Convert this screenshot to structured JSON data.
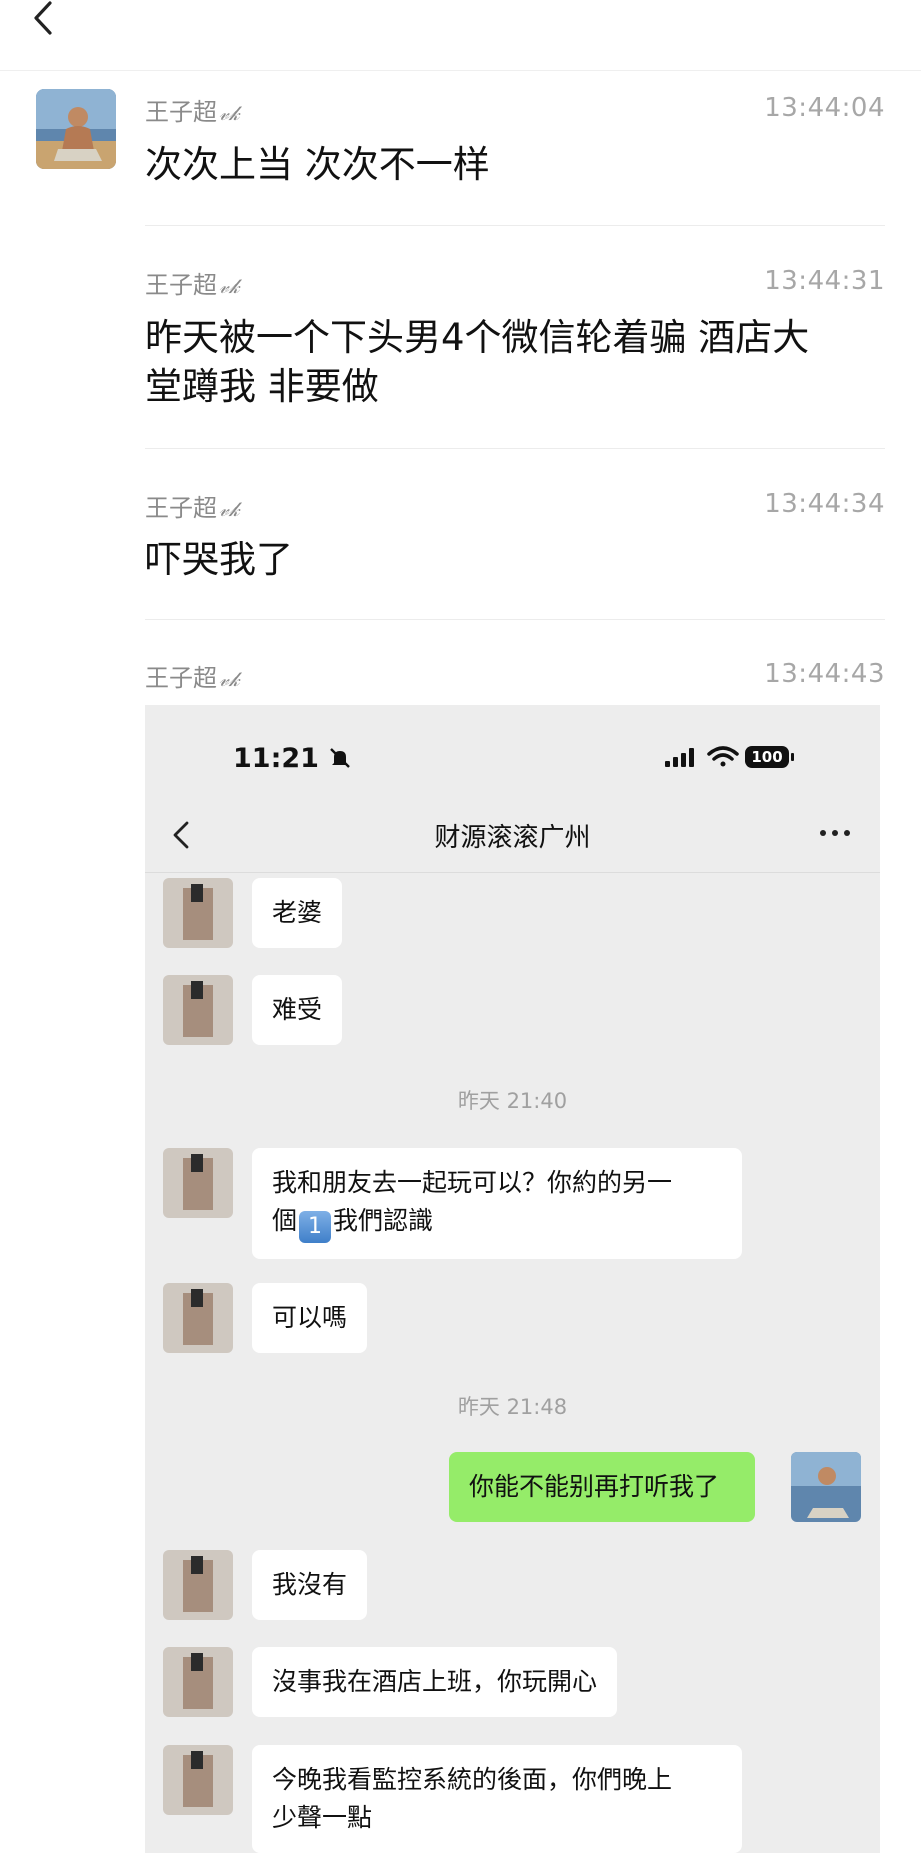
{
  "thread": {
    "messages": [
      {
        "sender": "王子超",
        "verified_mark": "𝓋𝓀",
        "time": "13:44:04",
        "text": "次次上当 次次不一样"
      },
      {
        "sender": "王子超",
        "verified_mark": "𝓋𝓀",
        "time": "13:44:31",
        "text_line1": "昨天被一个下头男4个微信轮着骗 酒店大",
        "text_line2": "堂蹲我 非要做"
      },
      {
        "sender": "王子超",
        "verified_mark": "𝓋𝓀",
        "time": "13:44:34",
        "text": "吓哭我了"
      },
      {
        "sender": "王子超",
        "verified_mark": "𝓋𝓀",
        "time": "13:44:43"
      }
    ]
  },
  "screenshot": {
    "status_time": "11:21",
    "battery": "100",
    "chat_title": "财源滚滚广州",
    "items": [
      {
        "type": "in",
        "text": "老婆"
      },
      {
        "type": "in",
        "text": "难受"
      },
      {
        "type": "timestamp",
        "text": "昨天 21:40"
      },
      {
        "type": "in",
        "line1": "我和朋友去一起玩可以？你約的另一",
        "line2_pre": "個",
        "emoji": "1",
        "line2_post": "我們認識"
      },
      {
        "type": "in",
        "text": "可以嗎"
      },
      {
        "type": "timestamp",
        "text": "昨天 21:48"
      },
      {
        "type": "out",
        "text": "你能不能别再打听我了"
      },
      {
        "type": "in",
        "text": "我沒有"
      },
      {
        "type": "in",
        "text": "沒事我在酒店上班，你玩開心"
      },
      {
        "type": "in",
        "line1": "今晚我看監控系統的後面，你們晚上",
        "line2": "少聲一點"
      }
    ]
  },
  "colors": {
    "outgoing_bubble": "#95ec69",
    "chat_background": "#ededed"
  }
}
